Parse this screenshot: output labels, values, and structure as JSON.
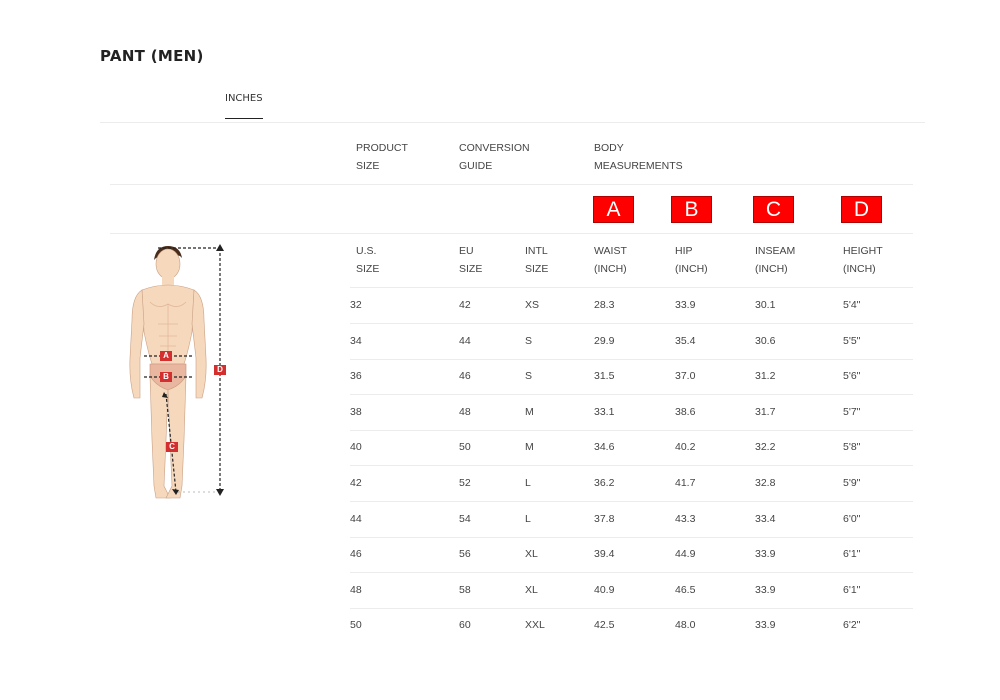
{
  "page": {
    "title": "PANT (MEN)"
  },
  "tabs": [
    {
      "label": "INCHES",
      "active": true
    }
  ],
  "header_groups": [
    {
      "line1": "PRODUCT",
      "line2": "SIZE"
    },
    {
      "line1": "CONVERSION",
      "line2": "GUIDE"
    },
    {
      "line1": "BODY",
      "line2": "MEASUREMENTS"
    }
  ],
  "keys": [
    "A",
    "B",
    "C",
    "D"
  ],
  "figure_markers": [
    "A",
    "B",
    "C",
    "D"
  ],
  "columns": [
    {
      "line1": "U.S.",
      "line2": "SIZE"
    },
    {
      "line1": "EU",
      "line2": "SIZE"
    },
    {
      "line1": "INTL",
      "line2": "SIZE"
    },
    {
      "line1": "WAIST",
      "line2": "(INCH)"
    },
    {
      "line1": "HIP",
      "line2": "(INCH)"
    },
    {
      "line1": "INSEAM",
      "line2": "(INCH)"
    },
    {
      "line1": "HEIGHT",
      "line2": "(INCH)"
    }
  ],
  "rows": [
    [
      "32",
      "42",
      "XS",
      "28.3",
      "33.9",
      "30.1",
      "5'4\""
    ],
    [
      "34",
      "44",
      "S",
      "29.9",
      "35.4",
      "30.6",
      "5'5\""
    ],
    [
      "36",
      "46",
      "S",
      "31.5",
      "37.0",
      "31.2",
      "5'6\""
    ],
    [
      "38",
      "48",
      "M",
      "33.1",
      "38.6",
      "31.7",
      "5'7\""
    ],
    [
      "40",
      "50",
      "M",
      "34.6",
      "40.2",
      "32.2",
      "5'8\""
    ],
    [
      "42",
      "52",
      "L",
      "36.2",
      "41.7",
      "32.8",
      "5'9\""
    ],
    [
      "44",
      "54",
      "L",
      "37.8",
      "43.3",
      "33.4",
      "6'0\""
    ],
    [
      "46",
      "56",
      "XL",
      "39.4",
      "44.9",
      "33.9",
      "6'1\""
    ],
    [
      "48",
      "58",
      "XL",
      "40.9",
      "46.5",
      "33.9",
      "6'1\""
    ],
    [
      "50",
      "60",
      "XXL",
      "42.5",
      "48.0",
      "33.9",
      "6'2\""
    ]
  ],
  "colors": {
    "key_badge": "#ff0000",
    "marker": "#d32f2f",
    "skin": "#f6d8bd",
    "brief": "#e9b6a0"
  }
}
